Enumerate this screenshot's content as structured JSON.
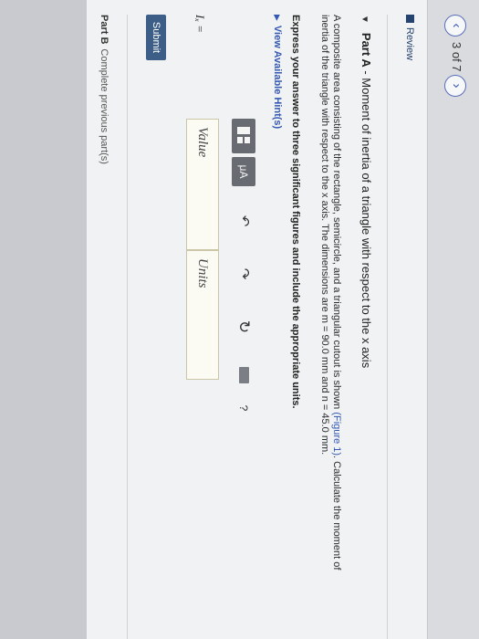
{
  "nav": {
    "pager": "3 of 7",
    "prev_symbol": "‹",
    "next_symbol": "›"
  },
  "review": {
    "label": "Review"
  },
  "part_a": {
    "title": "Part A",
    "subtitle": " - Moment of inertia of a triangle with respect to the x axis",
    "problem_1": "A composite area consisting of the rectangle, semicircle, and a triangular cutout is shown ",
    "figure_link": "(Figure 1)",
    "problem_2": ". Calculate the moment of inertia of the triangle with respect to the x axis. The dimensions are m = 90.0 mm and n = 45.0 mm.",
    "instruction": "Express your answer to three significant figures and include the appropriate units.",
    "hints_label": "View Available Hint(s)"
  },
  "toolbar": {
    "mu_label": "μA",
    "undo_symbol": "↶",
    "redo_symbol": "↷",
    "reset_symbol": "↻",
    "help_symbol": "?"
  },
  "answer": {
    "label": "Iₓ =",
    "value_placeholder": "Value",
    "units_placeholder": "Units"
  },
  "submit_label": "Submit",
  "part_b": {
    "title": "Part B",
    "status": "Complete previous part(s)"
  },
  "colors": {
    "accent": "#3459b5",
    "submit": "#3d5f87",
    "toolbar_dark": "#686b72"
  },
  "icons": [
    "chevron-left-icon",
    "chevron-right-icon",
    "review-icon",
    "caret-down-icon",
    "caret-right-icon",
    "template-icon",
    "mu-icon",
    "undo-icon",
    "redo-icon",
    "reset-icon",
    "keyboard-icon",
    "help-icon"
  ]
}
